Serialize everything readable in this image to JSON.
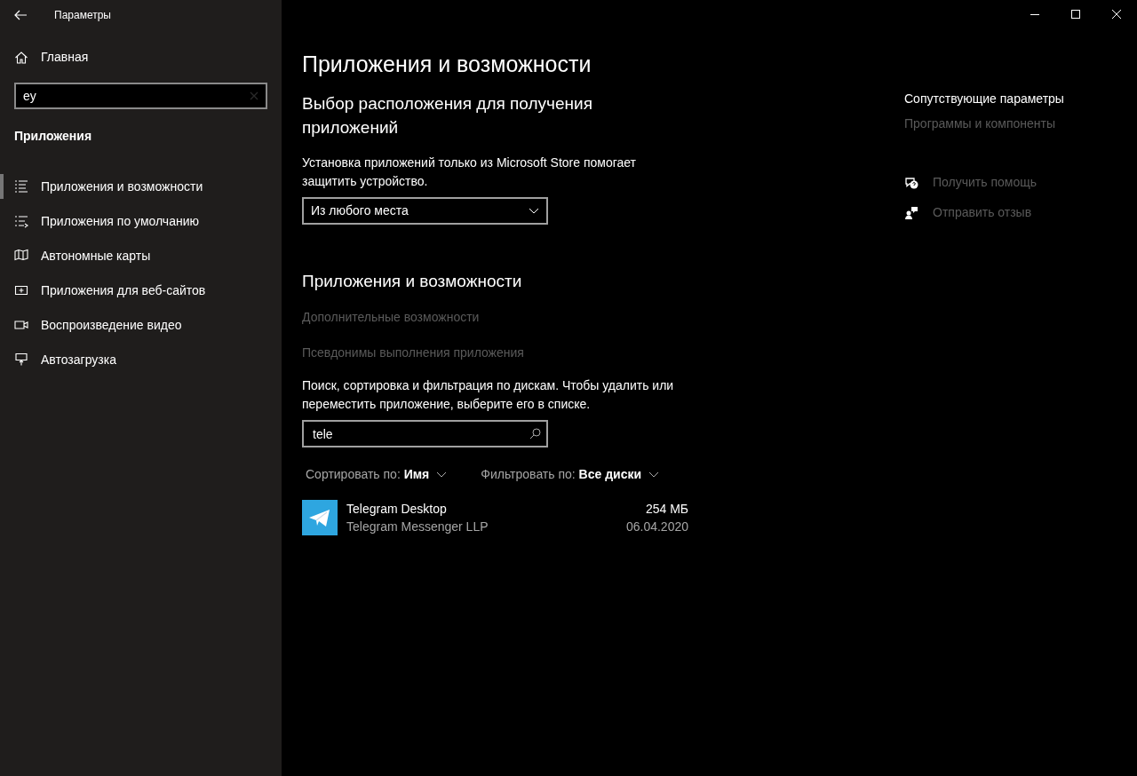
{
  "window": {
    "title": "Параметры"
  },
  "sidebar": {
    "home": "Главная",
    "search": {
      "value": "ey"
    },
    "section": "Приложения",
    "items": [
      {
        "label": "Приложения и возможности",
        "selected": true
      },
      {
        "label": "Приложения по умолчанию",
        "selected": false
      },
      {
        "label": "Автономные карты",
        "selected": false
      },
      {
        "label": "Приложения для веб-сайтов",
        "selected": false
      },
      {
        "label": "Воспроизведение видео",
        "selected": false
      },
      {
        "label": "Автозагрузка",
        "selected": false
      }
    ]
  },
  "main": {
    "title": "Приложения и возможности",
    "location": {
      "heading": "Выбор расположения для получения приложений",
      "description": "Установка приложений только из Microsoft Store помогает защитить устройство.",
      "dropdown": "Из любого места"
    },
    "apps": {
      "heading": "Приложения и возможности",
      "links": [
        "Дополнительные возможности",
        "Псевдонимы выполнения приложения"
      ],
      "description": "Поиск, сортировка и фильтрация по дискам. Чтобы удалить или переместить приложение, выберите его в списке.",
      "search": {
        "value": "tele"
      },
      "sort": {
        "label": "Сортировать по:",
        "value": "Имя"
      },
      "filter": {
        "label": "Фильтровать по:",
        "value": "Все диски"
      },
      "list": [
        {
          "name": "Telegram Desktop",
          "publisher": "Telegram Messenger LLP",
          "size": "254 МБ",
          "date": "06.04.2020"
        }
      ]
    }
  },
  "related": {
    "heading": "Сопутствующие параметры",
    "links": [
      "Программы и компоненты"
    ]
  },
  "help": [
    {
      "kind": "help",
      "label": "Получить помощь"
    },
    {
      "kind": "feedback",
      "label": "Отправить отзыв"
    }
  ]
}
